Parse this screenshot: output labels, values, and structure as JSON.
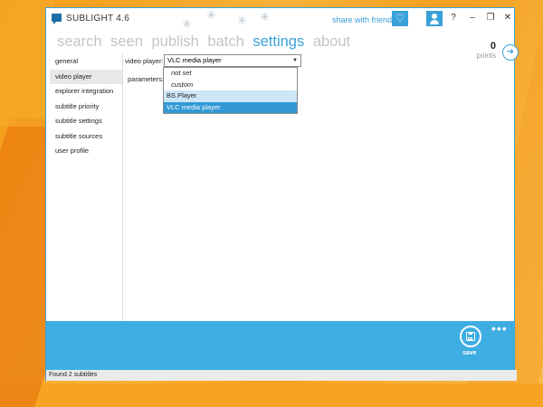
{
  "app": {
    "title": "SUBLIGHT 4.6"
  },
  "header": {
    "share_text": "share with friends",
    "window_controls": [
      "?",
      "–",
      "❐",
      "✕"
    ]
  },
  "nav": [
    {
      "label": "search",
      "active": false
    },
    {
      "label": "seen",
      "active": false
    },
    {
      "label": "publish",
      "active": false
    },
    {
      "label": "batch",
      "active": false
    },
    {
      "label": "settings",
      "active": true
    },
    {
      "label": "about",
      "active": false
    }
  ],
  "points": {
    "value": "0",
    "label": "points"
  },
  "sidebar": {
    "items": [
      {
        "label": "general"
      },
      {
        "label": "video player",
        "active": true
      },
      {
        "label": "explorer integration"
      },
      {
        "label": "subtitle priority"
      },
      {
        "label": "subtitle settings"
      },
      {
        "label": "subtitle sources"
      },
      {
        "label": "user profile"
      }
    ]
  },
  "settings": {
    "video_player_label": "video player:",
    "selected_player": "VLC media player",
    "parameters_label": "parameters:",
    "options": [
      "not set",
      "custom",
      "BS.Player",
      "VLC media player"
    ]
  },
  "footer": {
    "save_label": "save",
    "more": "•••"
  },
  "status": {
    "text": "Found 2 subtitles"
  },
  "icons": {
    "app_logo": "chat-bubble-icon",
    "heart": "heart-icon",
    "user": "user-icon",
    "arrow": "arrow-right-icon",
    "save": "floppy-disk-icon"
  },
  "colors": {
    "accent": "#3aa0d8",
    "bottom_bar": "#3eaee2",
    "selection": "#3399d6"
  }
}
